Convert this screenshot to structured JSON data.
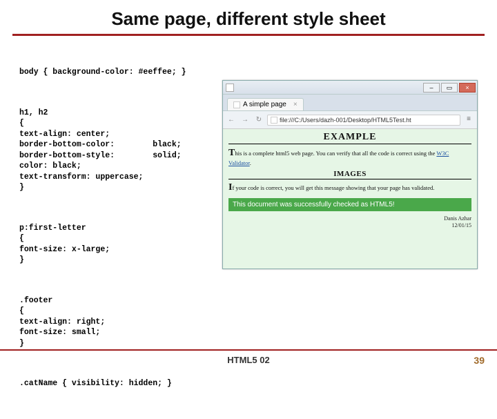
{
  "title": "Same page, different style sheet",
  "code": {
    "block1": "body { background-color: #eeffee; }",
    "block2": "h1, h2\n{\ntext-align: center;\nborder-bottom-color:        black;\nborder-bottom-style:        solid;\ncolor: black;\ntext-transform: uppercase;\n}",
    "block3": "p:first-letter\n{\nfont-size: x-large;\n}",
    "block4": ".footer\n{\ntext-align: right;\nfont-size: small;\n}",
    "block5": ".catName { visibility: hidden; }"
  },
  "browser": {
    "window_title": "",
    "controls": {
      "min": "–",
      "max": "▭",
      "close": "×"
    },
    "tab": {
      "label": "A simple page",
      "close": "×"
    },
    "nav": {
      "back": "←",
      "forward": "→",
      "reload": "↻"
    },
    "address": "file:///C:/Users/dazh-001/Desktop/HTML5Test.ht",
    "menu": "≡",
    "page": {
      "h1": "EXAMPLE",
      "p1_first": "T",
      "p1_rest": "his is a complete html5 web page. You can verify that all the code is correct using the ",
      "p1_link": "W3C Validator",
      "p1_end": ".",
      "h2": "IMAGES",
      "p2_first": "I",
      "p2_rest": "f your code is correct, you will get this message showing that your page has validated.",
      "banner": "This document was successfully checked as HTML5!",
      "footer_name": "Danis Azhar",
      "footer_date": "12/01/15"
    }
  },
  "footer": {
    "label": "HTML5 02",
    "page_number": "39"
  }
}
